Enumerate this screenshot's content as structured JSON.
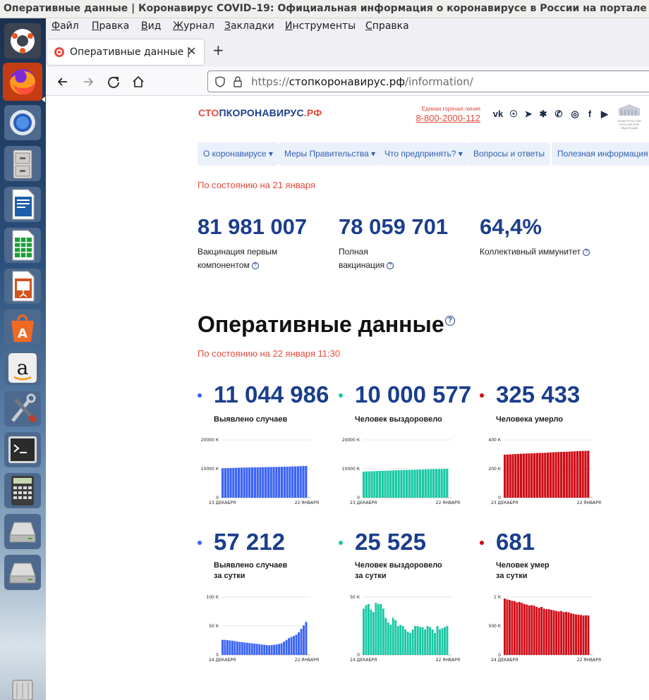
{
  "window_title": "Оперативные данные | Коронавирус COVID–19: Официальная информация о коронавирусе в России на портале – стопкоронавирус.рф",
  "menu": [
    {
      "label": "Файл",
      "u": "Ф"
    },
    {
      "label": "Правка",
      "u": "П"
    },
    {
      "label": "Вид",
      "u": "В"
    },
    {
      "label": "Журнал",
      "u": "Ж"
    },
    {
      "label": "Закладки",
      "u": "З"
    },
    {
      "label": "Инструменты",
      "u": "И"
    },
    {
      "label": "Справка",
      "u": "С"
    }
  ],
  "tab": {
    "title": "Оперативные данные | Коронавирус",
    "close": "✕"
  },
  "newtab": "+",
  "url": {
    "prefix": "https://",
    "host": "стопкоронавирус.рф",
    "path": "/information/"
  },
  "colors": {
    "blue": "#3a63f5",
    "teal": "#18c8a5",
    "red": "#d00a14",
    "brand_red": "#e54b3e",
    "brand_blue": "#1b3e8c"
  },
  "site": {
    "logo_a": "СТО",
    "logo_b": "П",
    "logo_c": "КОРОНАВИРУС",
    "logo_d": ".РФ",
    "hotline_label": "Единая горячая линия",
    "hotline_phone": "8-800-2000-112",
    "gov_label": "ПРАВИТЕЛЬСТВО РОССИЙСКОЙ ФЕДЕРАЦИИ",
    "social": [
      "vk-icon",
      "ok-icon",
      "telegram-icon",
      "odnoklassniki-icon",
      "viber-icon",
      "instagram-icon",
      "facebook-icon",
      "youtube-icon"
    ]
  },
  "nav": [
    "О коронавирусе ▾",
    "Меры Правительства ▾",
    "Что предпринять? ▾",
    "Вопросы и ответы",
    "Полезная информация ▾"
  ],
  "vacc": {
    "asof": "По состоянию на 21 января",
    "items": [
      {
        "value": "81 981 007",
        "line1": "Вакцинация первым",
        "line2": "компонентом"
      },
      {
        "value": "78 059 701",
        "line1": "Полная",
        "line2": "вакцинация"
      },
      {
        "value": "64,4%",
        "line1": "Коллективный иммунитет",
        "line2": ""
      }
    ]
  },
  "operative": {
    "title": "Оперативные данные",
    "asof": "По состоянию на 22 января 11:30",
    "stats": [
      {
        "value": "11 044 986",
        "label1": "Выявлено случаев",
        "label2": "",
        "color": "#3a63f5"
      },
      {
        "value": "10 000 577",
        "label1": "Человек выздоровело",
        "label2": "",
        "color": "#18c8a5"
      },
      {
        "value": "325 433",
        "label1": "Человека умерло",
        "label2": "",
        "color": "#d00a14"
      },
      {
        "value": "57 212",
        "label1": "Выявлено случаев",
        "label2": "за сутки",
        "color": "#3a63f5"
      },
      {
        "value": "25 525",
        "label1": "Человек выздоровело",
        "label2": "за сутки",
        "color": "#18c8a5"
      },
      {
        "value": "681",
        "label1": "Человек умер",
        "label2": "за сутки",
        "color": "#d00a14"
      }
    ]
  },
  "chart_data": [
    {
      "type": "bar",
      "title": "Выявлено случаев",
      "ylim": [
        0,
        20000
      ],
      "y_ticks": [
        "20000 К",
        "10000 К",
        "0"
      ],
      "x_labels": [
        "23 ДЕКАБРЯ",
        "22 ЯНВАРЯ"
      ],
      "unit": "тыс.",
      "values": [
        10190,
        10220,
        10250,
        10280,
        10310,
        10340,
        10370,
        10400,
        10420,
        10440,
        10460,
        10480,
        10500,
        10520,
        10540,
        10560,
        10580,
        10600,
        10620,
        10640,
        10660,
        10680,
        10700,
        10720,
        10750,
        10780,
        10810,
        10840,
        10880,
        10920,
        10960,
        11000
      ]
    },
    {
      "type": "bar",
      "title": "Человек выздоровело",
      "ylim": [
        0,
        20000
      ],
      "y_ticks": [
        "20000 К",
        "10000 К",
        "0"
      ],
      "x_labels": [
        "23 ДЕКАБРЯ",
        "22 ЯНВАРЯ"
      ],
      "unit": "тыс.",
      "values": [
        9030,
        9070,
        9110,
        9150,
        9190,
        9230,
        9270,
        9310,
        9340,
        9370,
        9400,
        9430,
        9460,
        9490,
        9520,
        9550,
        9580,
        9610,
        9640,
        9670,
        9700,
        9730,
        9760,
        9790,
        9820,
        9850,
        9870,
        9900,
        9920,
        9950,
        9970,
        10000
      ]
    },
    {
      "type": "bar",
      "title": "Человека умерло",
      "ylim": [
        0,
        400
      ],
      "y_ticks": [
        "400 К",
        "200 К",
        "0"
      ],
      "x_labels": [
        "23 ДЕКАБРЯ",
        "22 ЯНВАРЯ"
      ],
      "unit": "тыс.",
      "values": [
        298,
        299,
        300,
        301,
        302,
        303,
        304,
        305,
        306,
        306,
        307,
        308,
        309,
        310,
        310,
        311,
        312,
        313,
        314,
        315,
        316,
        317,
        317,
        318,
        319,
        320,
        321,
        322,
        323,
        324,
        324,
        325
      ]
    },
    {
      "type": "bar",
      "title": "Выявлено случаев за сутки",
      "ylim": [
        0,
        100
      ],
      "y_ticks": [
        "100 К",
        "50 К",
        "0"
      ],
      "x_labels": [
        "24 ДЕКАБРЯ",
        "22 ЯНВАРЯ"
      ],
      "unit": "тыс.",
      "values": [
        26,
        26,
        25.5,
        25,
        24.5,
        24,
        23,
        22.5,
        22,
        21.5,
        21,
        20.5,
        20,
        19.5,
        19,
        18.5,
        18,
        17.5,
        17,
        16.5,
        17,
        17.5,
        18,
        19,
        20,
        23,
        26,
        29,
        31,
        33,
        35,
        39,
        45,
        51,
        57
      ]
    },
    {
      "type": "bar",
      "title": "Человек выздоровело за сутки",
      "ylim": [
        0,
        50
      ],
      "y_ticks": [
        "50 К",
        "0"
      ],
      "x_labels": [
        "24 ДЕКАБРЯ",
        "22 ЯНВАРЯ"
      ],
      "unit": "тыс.",
      "values": [
        40,
        43,
        44,
        39,
        37,
        45,
        44,
        44,
        40,
        32,
        28,
        26,
        32,
        30,
        25,
        26,
        25,
        22,
        20,
        19,
        22,
        25,
        25,
        24,
        24,
        22,
        25,
        24,
        22,
        19,
        25,
        22,
        23,
        24,
        25
      ]
    },
    {
      "type": "bar",
      "title": "Человек умер за сутки",
      "ylim": [
        0,
        1000
      ],
      "y_ticks": [
        "1 К",
        "500 К",
        "0"
      ],
      "x_labels": [
        "24 ДЕКАБРЯ",
        "22 ЯНВАРЯ"
      ],
      "unit": "шт.",
      "values": [
        975,
        960,
        950,
        935,
        930,
        910,
        915,
        900,
        880,
        870,
        855,
        860,
        850,
        830,
        815,
        830,
        800,
        790,
        790,
        780,
        770,
        760,
        750,
        760,
        740,
        745,
        735,
        720,
        710,
        700,
        695,
        690,
        680,
        685,
        681
      ]
    }
  ]
}
